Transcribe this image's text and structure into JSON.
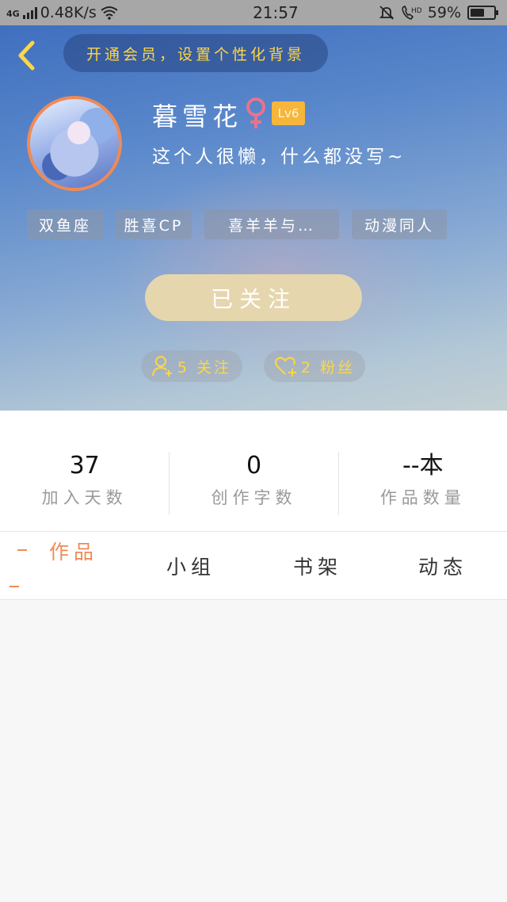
{
  "status_bar": {
    "network": "4G",
    "speed": "0.48K/s",
    "time": "21:57",
    "battery": "59%",
    "battery_level": 0.59
  },
  "header": {
    "vip_banner": "开通会员，设置个性化背景",
    "username": "暮雪花",
    "gender_symbol": "♀",
    "level": "Lv6",
    "bio": "这个人很懒，什么都没写~",
    "tags": [
      "双鱼座",
      "胜喜CP",
      "喜羊羊与…",
      "动漫同人"
    ],
    "follow_button": "已关注",
    "following": "5 关注",
    "followers": "2 粉丝"
  },
  "stats": [
    {
      "value": "37",
      "label": "加入天数"
    },
    {
      "value": "0",
      "label": "创作字数"
    },
    {
      "value": "--本",
      "label": "作品数量"
    }
  ],
  "tabs": [
    "作品",
    "小组",
    "书架",
    "动态"
  ],
  "colors": {
    "accent": "#f08a55",
    "vip_text": "#ffd644",
    "level_badge": "#f6b63b",
    "follow_button": "#e6d6ae",
    "gender": "#e6748e"
  }
}
